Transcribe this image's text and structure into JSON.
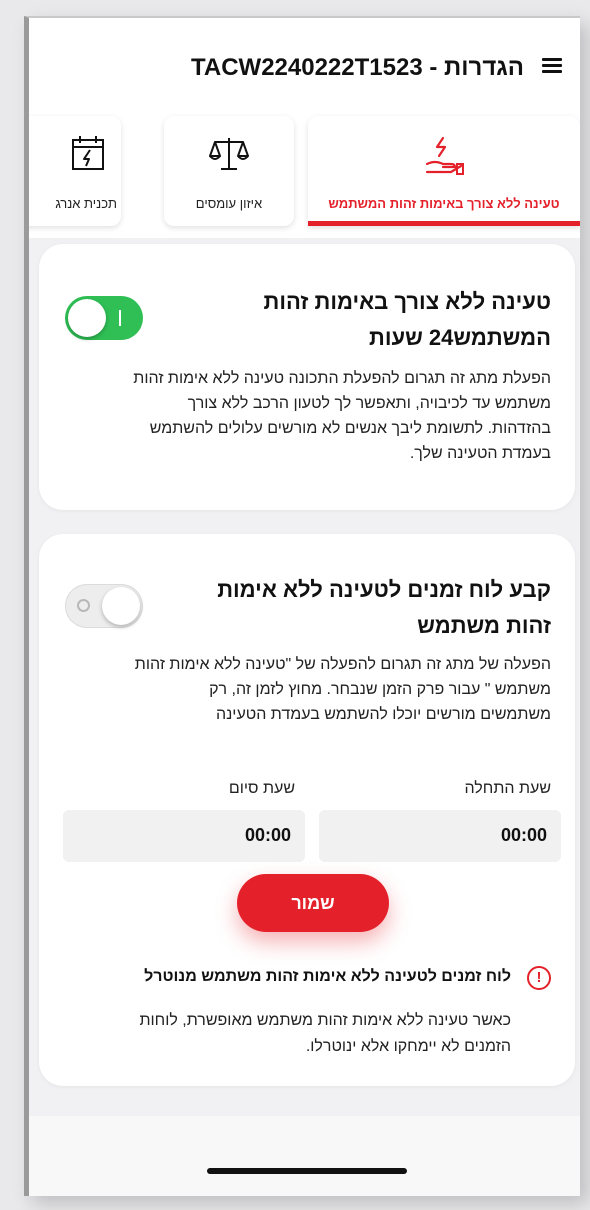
{
  "header": {
    "title": "הגדרות - TACW2240222T1523",
    "menu_icon": "hamburger-menu-icon"
  },
  "tabs": [
    {
      "label": "טעינה ללא צורך באימות זהות המשתמש",
      "icon": "hand-charging-icon",
      "active": true
    },
    {
      "label": "איזון עומסים",
      "icon": "balance-scale-icon",
      "active": false
    },
    {
      "label": "תכנית אנרג",
      "icon": "calendar-bolt-icon",
      "active": false
    }
  ],
  "card_no_auth": {
    "title_line1": "טעינה ללא צורך באימות זהות",
    "title_line2": "המשתמש24 שעות",
    "toggle_on": true,
    "description": [
      "הפעלת מתג זה תגרום להפעלת התכונה טעינה ללא אימות זהות",
      "משתמש עד לכיבויה, ותאפשר לך לטעון הרכב ללא צורך",
      "בהזדהות. לתשומת ליבך אנשים לא מורשים עלולים להשתמש",
      "בעמדת הטעינה שלך."
    ]
  },
  "card_schedule": {
    "title_line1": "קבע לוח זמנים לטעינה ללא אימות",
    "title_line2": "זהות משתמש",
    "toggle_on": false,
    "description": [
      "הפעלה של מתג זה תגרום להפעלה של \"טעינה ללא אימות זהות",
      "משתמש \" עבור פרק הזמן שנבחר. מחוץ לזמן זה, רק",
      "משתמשים מורשים יוכלו להשתמש בעמדת הטעינה"
    ],
    "start_label": "שעת התחלה",
    "end_label": "שעת סיום",
    "start_value": "00:00",
    "end_value": "00:00",
    "save_label": "שמור",
    "warning_title": "לוח זמנים לטעינה ללא אימות זהות משתמש מנוטרל",
    "warning_desc": [
      "כאשר טעינה ללא אימות זהות משתמש מאופשרת, לוחות",
      "הזמנים לא יימחקו אלא ינוטרלו."
    ]
  },
  "colors": {
    "accent": "#e4212a",
    "toggle_on": "#2fbf55"
  }
}
